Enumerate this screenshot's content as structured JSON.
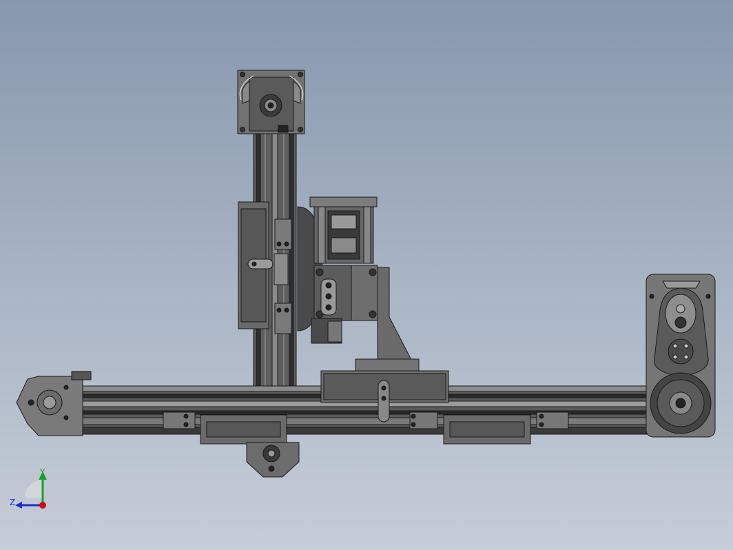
{
  "view": {
    "background_top": "#8797ad",
    "background_bottom": "#c6cdd8",
    "line_color": "#1a1a1a",
    "part_fill": "#6e6e6e",
    "part_fill_dark": "#3e3e3e",
    "part_fill_light": "#9a9a9a"
  },
  "triad": {
    "y_label": "Y",
    "z_label": "Z",
    "y_color": "#1a9e2a",
    "z_color": "#1a2fd0",
    "x_color": "#d01010"
  }
}
